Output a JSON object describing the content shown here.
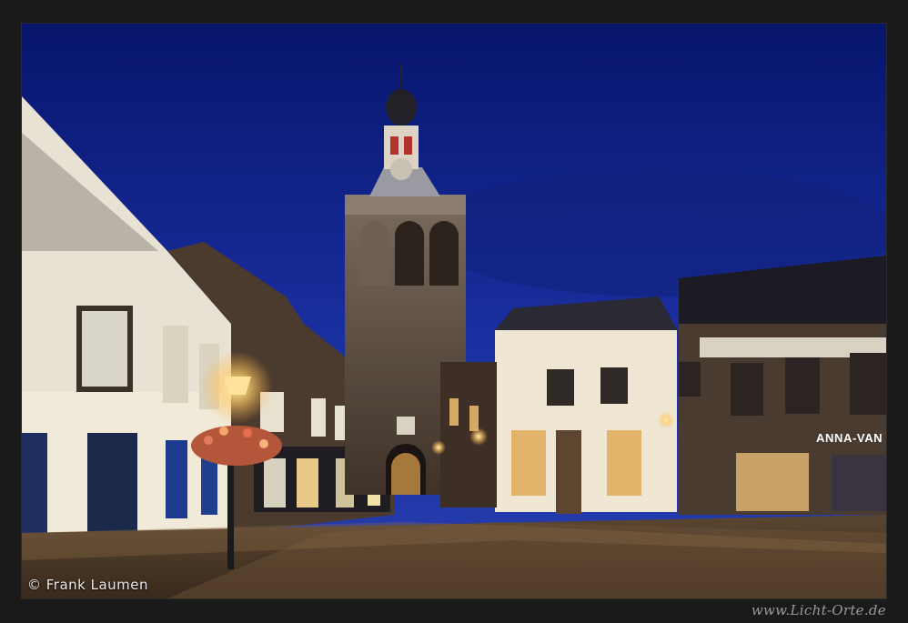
{
  "photo": {
    "shop_sign": "ANNA-VAN",
    "colors": {
      "sky_top": "#0a1a7a",
      "sky_bottom": "#2438a8",
      "lamp_glow": "#ffd27a",
      "border": "#1a1a1a"
    }
  },
  "credit": "© Frank Laumen",
  "website": "www.Licht-Orte.de"
}
